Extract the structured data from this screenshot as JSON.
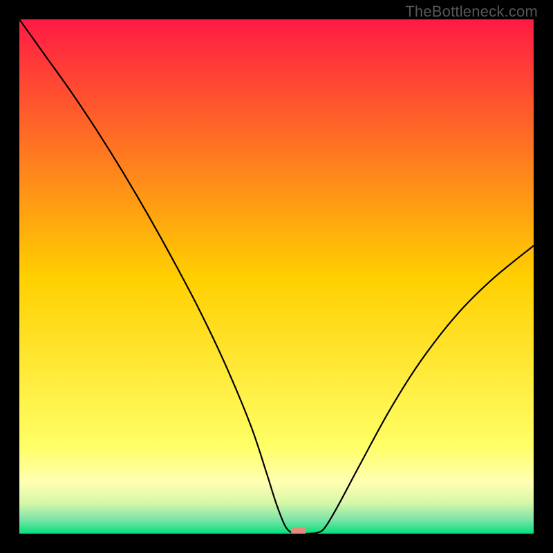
{
  "watermark": "TheBottleneck.com",
  "chart_data": {
    "type": "line",
    "title": "",
    "xlabel": "",
    "ylabel": "",
    "xlim": [
      0,
      100
    ],
    "ylim": [
      0,
      100
    ],
    "grid": false,
    "background_gradient": {
      "stops": [
        {
          "offset": 0.0,
          "color": "#ff1a44"
        },
        {
          "offset": 0.5,
          "color": "#ffcf00"
        },
        {
          "offset": 0.83,
          "color": "#ffff66"
        },
        {
          "offset": 0.9,
          "color": "#ffffb3"
        },
        {
          "offset": 0.94,
          "color": "#d7f7a8"
        },
        {
          "offset": 0.973,
          "color": "#7de3a8"
        },
        {
          "offset": 1.0,
          "color": "#00e27a"
        }
      ]
    },
    "series": [
      {
        "name": "bottleneck-curve",
        "color": "#000000",
        "x": [
          0.0,
          5,
          10,
          15,
          20,
          25,
          30,
          35,
          40,
          45,
          48,
          50,
          51.8,
          53.5,
          55.5,
          58,
          59.5,
          62,
          66,
          72,
          78,
          85,
          92,
          100
        ],
        "y": [
          100,
          93,
          86,
          78.5,
          70.5,
          62,
          53,
          43.5,
          33,
          21,
          12,
          5.7,
          1.3,
          0.0,
          0.0,
          0.2,
          1.3,
          5.5,
          13,
          24,
          33.5,
          42.5,
          49.5,
          56
        ]
      }
    ],
    "marker": {
      "name": "optimal-point",
      "x": 54.3,
      "y": 0.4,
      "color": "#e58a77",
      "shape": "pill"
    }
  }
}
